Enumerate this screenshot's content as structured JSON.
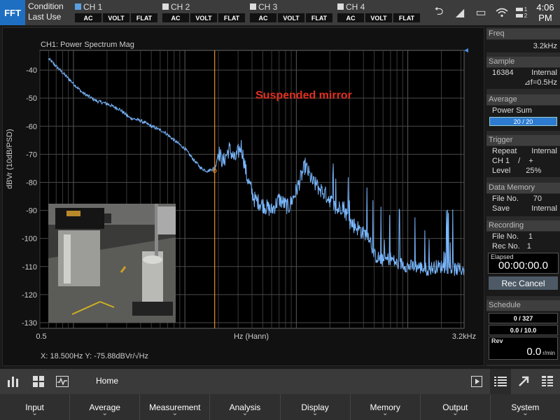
{
  "topbar": {
    "mode": "FFT",
    "condition_title": "Condition",
    "condition_sub": "Last Use",
    "channels": [
      {
        "name": "CH 1",
        "active": true,
        "coupling": "AC",
        "unit": "VOLT",
        "filter": "FLAT"
      },
      {
        "name": "CH 2",
        "active": false,
        "coupling": "AC",
        "unit": "VOLT",
        "filter": "FLAT"
      },
      {
        "name": "CH 3",
        "active": false,
        "coupling": "AC",
        "unit": "VOLT",
        "filter": "FLAT"
      },
      {
        "name": "CH 4",
        "active": false,
        "coupling": "AC",
        "unit": "VOLT",
        "filter": "FLAT"
      }
    ],
    "clock_time": "4:06",
    "clock_ampm": "PM",
    "battery_1": "1",
    "battery_2": "2",
    "icons": [
      "return-icon",
      "chart-toggle-icon",
      "drive-icon",
      "wifi-icon",
      "battery-icon"
    ]
  },
  "plot": {
    "title": "CH1: Power Spectrum Mag",
    "ylabel": "dBVr (10dB/PSD)",
    "xlabel": "Hz (Hann)",
    "x_start": "0.5",
    "x_end": "3.2kHz",
    "annotation": "Suspended mirror",
    "readout": "X: 18.500Hz Y: -75.88dBVr/√Hz",
    "y_ticks": [
      "-40",
      "-50",
      "-60",
      "-70",
      "-80",
      "-90",
      "-100",
      "-110",
      "-120",
      "-130"
    ],
    "trace_color": "#7ab8ff",
    "cursor_color": "#f0902a",
    "annotation_color": "#e03020"
  },
  "chart_data": {
    "type": "line",
    "title": "CH1: Power Spectrum Mag",
    "xlabel": "Hz (Hann)",
    "ylabel": "dBVr (10dB/PSD)",
    "xscale": "log",
    "xlim": [
      0.5,
      3200
    ],
    "ylim": [
      -132,
      -33
    ],
    "grid": true,
    "cursor_x": 18.5,
    "series": [
      {
        "x": [
          0.6,
          0.9,
          1.2,
          1.6,
          2.0,
          2.6,
          3.2,
          4.0,
          5.0,
          6.5,
          8.0,
          10,
          12,
          14,
          16,
          18,
          18.5,
          20,
          22,
          25,
          28,
          32,
          36,
          42,
          50,
          60,
          70,
          85,
          100,
          120,
          140,
          170,
          200,
          230,
          260,
          300,
          350,
          400,
          450,
          500,
          600,
          700,
          800,
          900,
          1000,
          1200,
          1500,
          1800,
          2200,
          2600,
          3200
        ],
        "y": [
          -36,
          -43,
          -48,
          -51,
          -52,
          -54,
          -57,
          -58,
          -60,
          -62,
          -65,
          -68,
          -72,
          -75,
          -76,
          -75,
          -76,
          -69,
          -73,
          -68,
          -72,
          -67,
          -78,
          -86,
          -88,
          -90,
          -86,
          -89,
          -83,
          -74,
          -80,
          -83,
          -86,
          -90,
          -88,
          -94,
          -96,
          -98,
          -99,
          -106,
          -108,
          -107,
          -109,
          -109,
          -110,
          -110,
          -111,
          -110,
          -110,
          -111,
          -111
        ]
      }
    ]
  },
  "sidebar": {
    "freq_title": "Freq",
    "freq_value": "3.2kHz",
    "sample_title": "Sample",
    "sample_count": "16384",
    "sample_source": "Internal",
    "sample_df": "⊿f=0.5Hz",
    "average_title": "Average",
    "average_mode": "Power Sum",
    "average_progress": "20 / 20",
    "average_fraction": 1.0,
    "trigger_title": "Trigger",
    "trigger_repeat_label": "Repeat",
    "trigger_repeat_value": "Internal",
    "trigger_ch_label": "CH 1",
    "trigger_ch_value": "/    +",
    "trigger_level_label": "Level",
    "trigger_level_value": "25%",
    "datamem_title": "Data Memory",
    "datamem_file_label": "File No.",
    "datamem_file_value": "70",
    "datamem_save_label": "Save",
    "datamem_save_value": "Internal",
    "rec_title": "Recording",
    "rec_file_label": "File No.",
    "rec_file_value": "1",
    "rec_recno_label": "Rec No.",
    "rec_recno_value": "1",
    "elapsed_label": "Elapsed",
    "elapsed_value": "00:00:00.0",
    "rec_cancel": "Rec Cancel",
    "schedule_title": "Schedule",
    "sched_count": "0 / 327",
    "sched_time": "0.0 / 10.0",
    "rev_label": "Rev",
    "rev_value": "0.0",
    "rev_unit": "r/min"
  },
  "toolbar": {
    "home": "Home"
  },
  "menu": [
    "Input",
    "Average",
    "Measurement",
    "Analysis",
    "Display",
    "Memory",
    "Output",
    "System"
  ]
}
